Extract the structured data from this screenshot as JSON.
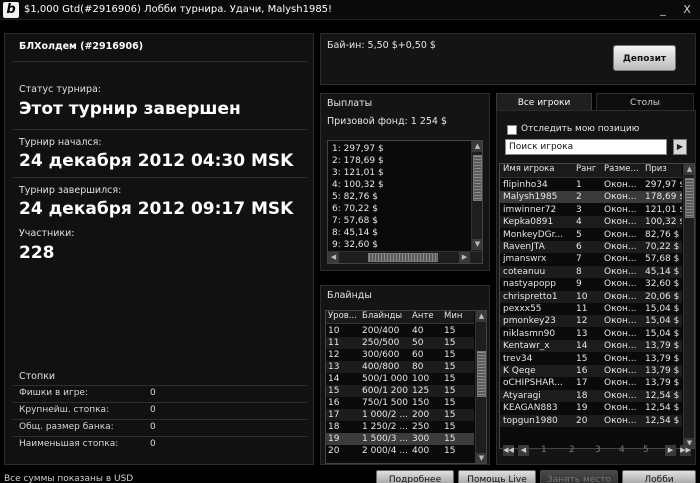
{
  "window": {
    "title": "$1,000 Gtd(#2916906) Лобби турнира. Удачи, Malysh1985!",
    "minimize": "_",
    "close": "X"
  },
  "tournament": {
    "name": "БЛХолдем (#2916906)",
    "status_label": "Статус турнира:",
    "status_value": "Этот турнир завершен",
    "started_label": "Турнир начался:",
    "started_value": "24 декабря 2012   04:30 MSK",
    "ended_label": "Турнир завершился:",
    "ended_value": "24 декабря 2012   09:17 MSK",
    "participants_label": "Участники:",
    "participants_value": "228"
  },
  "stacks": {
    "title": "Стопки",
    "rows": [
      {
        "label": "Фишки в игре:",
        "value": "0"
      },
      {
        "label": "Крупнейш. стопка:",
        "value": "0"
      },
      {
        "label": "Общ. размер банка:",
        "value": "0"
      },
      {
        "label": "Наименьшая стопка:",
        "value": "0"
      }
    ]
  },
  "buyin": {
    "text": "Бай-ин: 5,50 $+0,50 $",
    "deposit_label": "Депозит"
  },
  "payouts": {
    "title": "Выплаты",
    "prize_pool": "Призовой фонд: 1 254 $",
    "rows": [
      "1: 297,97 $",
      "2: 178,69 $",
      "3: 121,01 $",
      "4: 100,32 $",
      "5: 82,76 $",
      "6: 70,22 $",
      "7: 57,68 $",
      "8: 45,14 $",
      "9: 32,60 $"
    ]
  },
  "blinds": {
    "title": "Блайнды",
    "headers": [
      "Уров...",
      "Блайнды",
      "Анте",
      "Мин"
    ],
    "rows": [
      [
        "10",
        "200/400",
        "40",
        "15"
      ],
      [
        "11",
        "250/500",
        "50",
        "15"
      ],
      [
        "12",
        "300/600",
        "60",
        "15"
      ],
      [
        "13",
        "400/800",
        "80",
        "15"
      ],
      [
        "14",
        "500/1 000",
        "100",
        "15"
      ],
      [
        "15",
        "600/1 200",
        "125",
        "15"
      ],
      [
        "16",
        "750/1 500",
        "150",
        "15"
      ],
      [
        "17",
        "1 000/2 ...",
        "200",
        "15"
      ],
      [
        "18",
        "1 250/2 ...",
        "250",
        "15"
      ],
      [
        "19",
        "1 500/3 ...",
        "300",
        "15"
      ],
      [
        "20",
        "2 000/4 ...",
        "400",
        "15"
      ]
    ],
    "selected_index": 9
  },
  "players": {
    "tab_all": "Все игроки",
    "tab_tables": "Столы",
    "track_label": "Отследить мою позицию",
    "search_value": "Поиск игрока",
    "headers": [
      "Имя игрока",
      "Ранг",
      "Разме...",
      "Приз"
    ],
    "selected_index": 1,
    "rows": [
      [
        "flipinho34",
        "1",
        "Окон...",
        "297,97 $"
      ],
      [
        "Malysh1985",
        "2",
        "Окон...",
        "178,69 $"
      ],
      [
        "imwinner72",
        "3",
        "Окон...",
        "121,01 $"
      ],
      [
        "Kepka0891",
        "4",
        "Окон...",
        "100,32 $"
      ],
      [
        "MonkeyDGr...",
        "5",
        "Окон...",
        "82,76 $"
      ],
      [
        "RavenJTA",
        "6",
        "Окон...",
        "70,22 $"
      ],
      [
        "jmanswrx",
        "7",
        "Окон...",
        "57,68 $"
      ],
      [
        "coteanuu",
        "8",
        "Окон...",
        "45,14 $"
      ],
      [
        "nastyapopp",
        "9",
        "Окон...",
        "32,60 $"
      ],
      [
        "chrispretto1",
        "10",
        "Окон...",
        "20,06 $"
      ],
      [
        "pexxx55",
        "11",
        "Окон...",
        "15,04 $"
      ],
      [
        "pmonkey23",
        "12",
        "Окон...",
        "15,04 $"
      ],
      [
        "niklasmn90",
        "13",
        "Окон...",
        "15,04 $"
      ],
      [
        "Kentawr_x",
        "14",
        "Окон...",
        "13,79 $"
      ],
      [
        "trev34",
        "15",
        "Окон...",
        "13,79 $"
      ],
      [
        "K Qeqe",
        "16",
        "Окон...",
        "13,79 $"
      ],
      [
        "oCHIPSHAR...",
        "17",
        "Окон...",
        "13,79 $"
      ],
      [
        "Atyaragi",
        "18",
        "Окон...",
        "12,54 $"
      ],
      [
        "KEAGAN883",
        "19",
        "Окон...",
        "12,54 $"
      ],
      [
        "topgun1980",
        "20",
        "Окон...",
        "12,54 $"
      ]
    ],
    "pages": [
      "1",
      "2",
      "3",
      "4",
      "5"
    ]
  },
  "footer": {
    "note": "Все суммы показаны в USD",
    "details": "Подробнее",
    "help_live": "Помощь Live",
    "take_seat": "Занять место",
    "lobby": "Лобби"
  }
}
